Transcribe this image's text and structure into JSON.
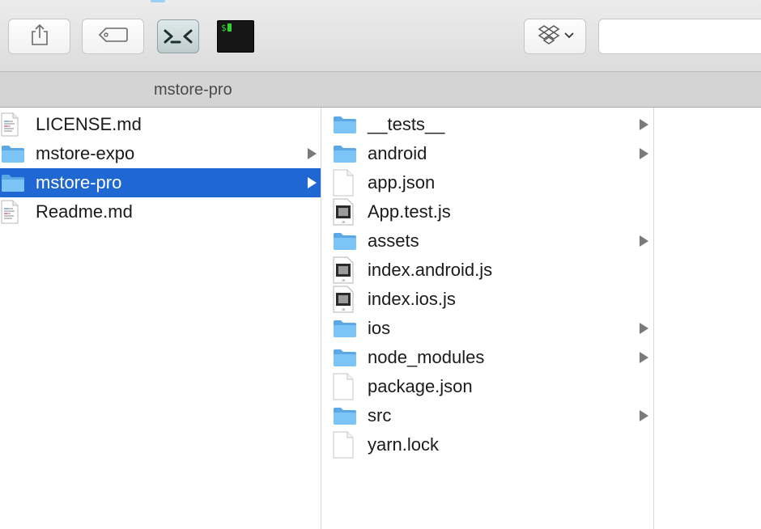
{
  "window": {
    "path_title": "mstore-pro"
  },
  "toolbar": {
    "terminal_prompt": "$",
    "search_placeholder": ""
  },
  "icons": {
    "share": "share-icon",
    "tag": "tag-icon",
    "vscode": "vscode-icon",
    "terminal": "terminal-icon",
    "dropbox": "dropbox-icon"
  },
  "colors": {
    "selection": "#1f67d2",
    "folder": "#6bbcf2",
    "terminal_green": "#2fd32f"
  },
  "columns": [
    {
      "items": [
        {
          "name": "LICENSE.md",
          "kind": "text-doc",
          "has_children": false,
          "selected": false
        },
        {
          "name": "mstore-expo",
          "kind": "folder",
          "has_children": true,
          "selected": false
        },
        {
          "name": "mstore-pro",
          "kind": "folder",
          "has_children": true,
          "selected": true
        },
        {
          "name": "Readme.md",
          "kind": "text-doc",
          "has_children": false,
          "selected": false
        }
      ]
    },
    {
      "items": [
        {
          "name": "__tests__",
          "kind": "folder",
          "has_children": true
        },
        {
          "name": "android",
          "kind": "folder",
          "has_children": true
        },
        {
          "name": "app.json",
          "kind": "blank-doc",
          "has_children": false
        },
        {
          "name": "App.test.js",
          "kind": "js-doc",
          "has_children": false
        },
        {
          "name": "assets",
          "kind": "folder",
          "has_children": true
        },
        {
          "name": "index.android.js",
          "kind": "js-doc",
          "has_children": false
        },
        {
          "name": "index.ios.js",
          "kind": "js-doc",
          "has_children": false
        },
        {
          "name": "ios",
          "kind": "folder",
          "has_children": true
        },
        {
          "name": "node_modules",
          "kind": "folder",
          "has_children": true
        },
        {
          "name": "package.json",
          "kind": "blank-doc",
          "has_children": false
        },
        {
          "name": "src",
          "kind": "folder",
          "has_children": true
        },
        {
          "name": "yarn.lock",
          "kind": "blank-doc",
          "has_children": false
        }
      ]
    }
  ]
}
